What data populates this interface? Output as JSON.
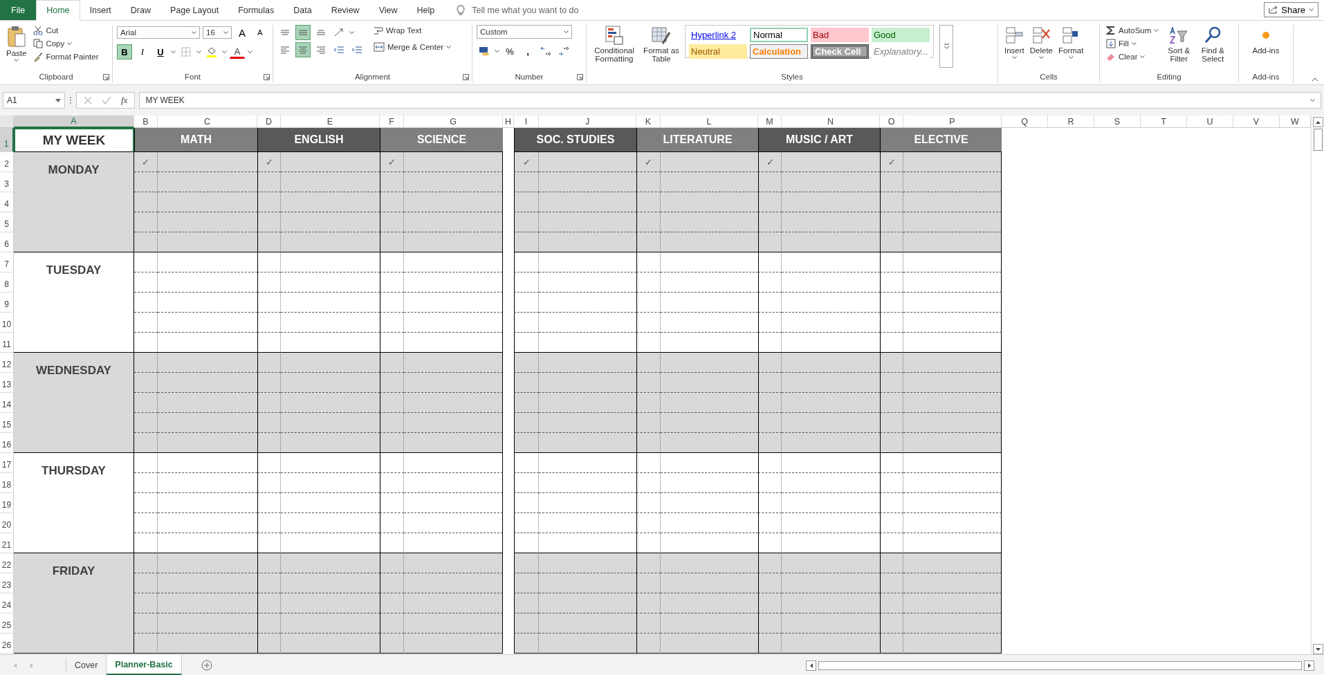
{
  "menu_tabs": [
    {
      "label": "File",
      "kind": "file",
      "selected": false
    },
    {
      "label": "Home",
      "kind": "tab",
      "selected": true
    },
    {
      "label": "Insert",
      "kind": "tab",
      "selected": false
    },
    {
      "label": "Draw",
      "kind": "tab",
      "selected": false
    },
    {
      "label": "Page Layout",
      "kind": "tab",
      "selected": false
    },
    {
      "label": "Formulas",
      "kind": "tab",
      "selected": false
    },
    {
      "label": "Data",
      "kind": "tab",
      "selected": false
    },
    {
      "label": "Review",
      "kind": "tab",
      "selected": false
    },
    {
      "label": "View",
      "kind": "tab",
      "selected": false
    },
    {
      "label": "Help",
      "kind": "tab",
      "selected": false
    }
  ],
  "tell_me": {
    "placeholder": "Tell me what you want to do"
  },
  "share_button": "Share",
  "ribbon": {
    "clipboard": {
      "label": "Clipboard",
      "paste": "Paste",
      "cut": "Cut",
      "copy": "Copy",
      "format_painter": "Format Painter"
    },
    "font": {
      "label": "Font",
      "font_name": "Arial",
      "font_size": "16",
      "grow_font": "A",
      "shrink_font": "A",
      "font_color": "A",
      "styles": [
        {
          "label": "B",
          "selected": true
        },
        {
          "label": "I",
          "selected": false
        },
        {
          "label": "U",
          "selected": false
        }
      ]
    },
    "alignment": {
      "label": "Alignment",
      "vertical": [
        {
          "selected": false
        },
        {
          "selected": true
        },
        {
          "selected": false
        }
      ],
      "horizontal": [
        {
          "selected": false
        },
        {
          "selected": true
        },
        {
          "selected": false
        }
      ],
      "wrap_text": "Wrap Text",
      "merge_center": "Merge & Center"
    },
    "number": {
      "label": "Number",
      "format": "Custom",
      "percent": "%",
      "comma": ","
    },
    "styles": {
      "label": "Styles",
      "conditional_formatting": "Conditional Formatting",
      "format_as_table": "Format as Table",
      "items": [
        {
          "label": "Hyperlink 2",
          "kind": "hyperlink"
        },
        {
          "label": "Normal",
          "kind": "normal"
        },
        {
          "label": "Bad",
          "kind": "bad"
        },
        {
          "label": "Good",
          "kind": "good"
        },
        {
          "label": "Neutral",
          "kind": "neutral"
        },
        {
          "label": "Calculation",
          "kind": "calculation"
        },
        {
          "label": "Check Cell",
          "kind": "check"
        },
        {
          "label": "Explanatory...",
          "kind": "explanatory"
        }
      ]
    },
    "cells": {
      "label": "Cells",
      "buttons": [
        "Insert",
        "Delete",
        "Format"
      ]
    },
    "editing": {
      "label": "Editing",
      "autosum": "AutoSum",
      "fill": "Fill",
      "clear": "Clear",
      "sort_filter": "Sort & Filter",
      "find_select": "Find & Select"
    },
    "addins": {
      "label": "Add-ins",
      "button": "Add-ins"
    }
  },
  "formula_bar": {
    "name_box": "A1",
    "fx": "fx",
    "formula": "MY WEEK"
  },
  "columns": [
    {
      "label": "A",
      "selected": true
    },
    {
      "label": "B",
      "selected": false
    },
    {
      "label": "C",
      "selected": false
    },
    {
      "label": "D",
      "selected": false
    },
    {
      "label": "E",
      "selected": false
    },
    {
      "label": "F",
      "selected": false
    },
    {
      "label": "G",
      "selected": false
    },
    {
      "label": "H",
      "selected": false
    },
    {
      "label": "I",
      "selected": false
    },
    {
      "label": "J",
      "selected": false
    },
    {
      "label": "K",
      "selected": false
    },
    {
      "label": "L",
      "selected": false
    },
    {
      "label": "M",
      "selected": false
    },
    {
      "label": "N",
      "selected": false
    },
    {
      "label": "O",
      "selected": false
    },
    {
      "label": "P",
      "selected": false
    },
    {
      "label": "Q",
      "selected": false
    },
    {
      "label": "R",
      "selected": false
    },
    {
      "label": "S",
      "selected": false
    },
    {
      "label": "T",
      "selected": false
    },
    {
      "label": "U",
      "selected": false
    },
    {
      "label": "V",
      "selected": false
    },
    {
      "label": "W",
      "selected": false
    }
  ],
  "rows": [
    {
      "label": "1",
      "selected": true
    },
    {
      "label": "2",
      "selected": false
    },
    {
      "label": "3",
      "selected": false
    },
    {
      "label": "4",
      "selected": false
    },
    {
      "label": "5",
      "selected": false
    },
    {
      "label": "6",
      "selected": false
    },
    {
      "label": "7",
      "selected": false
    },
    {
      "label": "8",
      "selected": false
    },
    {
      "label": "9",
      "selected": false
    },
    {
      "label": "10",
      "selected": false
    },
    {
      "label": "11",
      "selected": false
    },
    {
      "label": "12",
      "selected": false
    },
    {
      "label": "13",
      "selected": false
    },
    {
      "label": "14",
      "selected": false
    },
    {
      "label": "15",
      "selected": false
    },
    {
      "label": "16",
      "selected": false
    },
    {
      "label": "17",
      "selected": false
    },
    {
      "label": "18",
      "selected": false
    },
    {
      "label": "19",
      "selected": false
    },
    {
      "label": "20",
      "selected": false
    },
    {
      "label": "21",
      "selected": false
    },
    {
      "label": "22",
      "selected": false
    },
    {
      "label": "23",
      "selected": false
    },
    {
      "label": "24",
      "selected": false
    },
    {
      "label": "25",
      "selected": false
    },
    {
      "label": "26",
      "selected": false
    }
  ],
  "sheet": {
    "title": "MY WEEK",
    "subjects": [
      {
        "label": "MATH",
        "color": "#7f7f7f",
        "check": "✓"
      },
      {
        "label": "ENGLISH",
        "color": "#595959",
        "check": "✓"
      },
      {
        "label": "SCIENCE",
        "color": "#7f7f7f",
        "check": "✓"
      },
      {
        "label": "SOC. STUDIES",
        "color": "#595959",
        "check": "✓"
      },
      {
        "label": "LITERATURE",
        "color": "#7f7f7f",
        "check": "✓"
      },
      {
        "label": "MUSIC / ART",
        "color": "#595959",
        "check": "✓"
      },
      {
        "label": "ELECTIVE",
        "color": "#7f7f7f",
        "check": "✓"
      }
    ],
    "days": [
      {
        "label": "MONDAY",
        "shaded": true
      },
      {
        "label": "TUESDAY",
        "shaded": false
      },
      {
        "label": "WEDNESDAY",
        "shaded": true
      },
      {
        "label": "THURSDAY",
        "shaded": false
      },
      {
        "label": "FRIDAY",
        "shaded": true
      }
    ]
  },
  "sheet_tabs": [
    {
      "label": "Cover",
      "selected": false
    },
    {
      "label": "Planner-Basic",
      "selected": true
    }
  ]
}
